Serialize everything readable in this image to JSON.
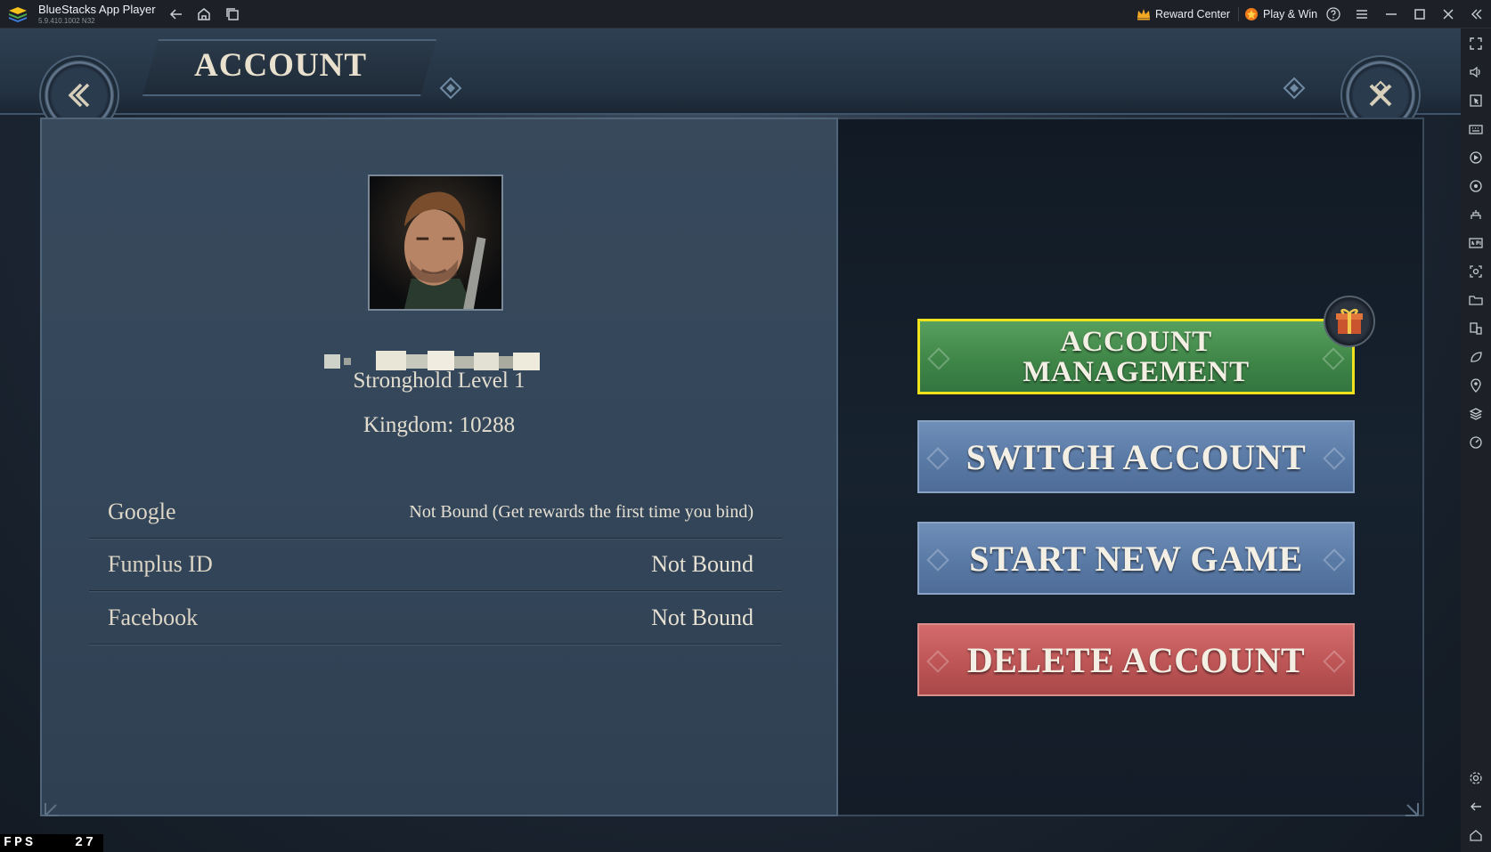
{
  "app": {
    "title": "BlueStacks App Player",
    "version": "5.9.410.1002 N32",
    "reward_center": "Reward Center",
    "play_win": "Play & Win"
  },
  "game": {
    "screen_title": "ACCOUNT",
    "player": {
      "stronghold": "Stronghold Level 1",
      "kingdom": "Kingdom: 10288"
    },
    "bindings": [
      {
        "label": "Google",
        "value": "Not Bound (Get rewards the first time you bind)"
      },
      {
        "label": "Funplus ID",
        "value": "Not Bound"
      },
      {
        "label": "Facebook",
        "value": "Not Bound"
      }
    ],
    "buttons": {
      "account_management": "ACCOUNT MANAGEMENT",
      "switch_account": "SWITCH ACCOUNT",
      "start_new_game": "START NEW GAME",
      "delete_account": "DELETE ACCOUNT"
    }
  },
  "fps": {
    "label": "FPS",
    "value": "27"
  },
  "icons": {
    "titlebar": [
      "bluestacks-logo-icon",
      "back-icon",
      "home-icon",
      "multi-instance-icon",
      "crown-icon",
      "play-win-icon",
      "help-icon",
      "menu-icon",
      "minimize-icon",
      "maximize-icon",
      "close-icon",
      "collapse-icon"
    ],
    "sidebar": [
      "fullscreen-icon",
      "volume-icon",
      "cursor-icon",
      "keyboard-icon",
      "record-icon",
      "macro-icon",
      "controls-icon",
      "apk-icon",
      "screenshot-icon",
      "folder-icon",
      "multi-window-icon",
      "eco-mode-icon",
      "location-icon",
      "layers-icon",
      "speed-icon",
      "settings-icon",
      "android-back-icon",
      "android-home-icon",
      "recent-apps-icon"
    ]
  },
  "colors": {
    "highlight": "#f0e21c",
    "green_button": "#3f8648",
    "blue_button": "#5a7aa6",
    "red_button": "#bd5556"
  }
}
